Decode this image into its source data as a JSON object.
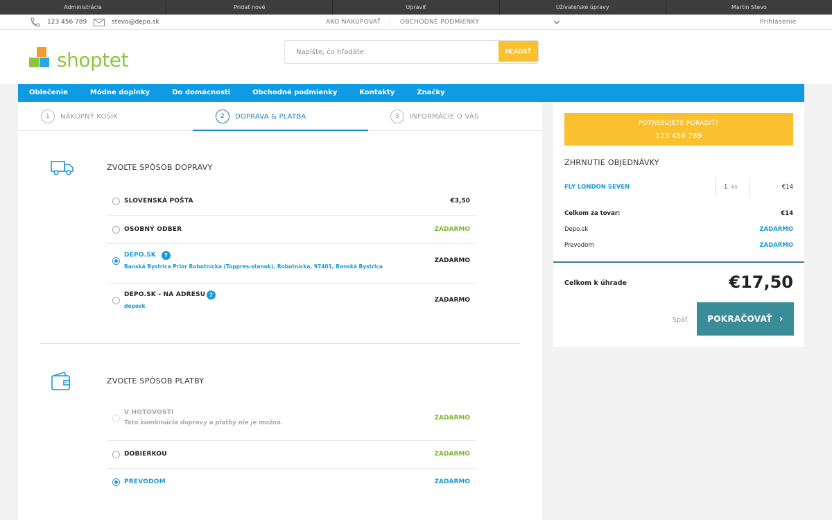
{
  "admin_bar": [
    "Administrácia",
    "Pridať nové",
    "Upraviť",
    "Užívateľské úpravy",
    "Martin Stevo"
  ],
  "topbar": {
    "phone": "123 456 789",
    "email": "stevo@depo.sk",
    "links": [
      "AKO NAKUPOVAŤ",
      "OBCHODNÉ PODMIENKY"
    ],
    "login": "Prihlásenie"
  },
  "header": {
    "logo_text": "shoptet",
    "search_placeholder": "Napíšte, čo hľadáte",
    "search_button": "HĽADAŤ"
  },
  "nav": [
    "Oblečenie",
    "Módne doplnky",
    "Do domácnosti",
    "Obchodné podmienky",
    "Kontakty",
    "Značky"
  ],
  "steps": [
    {
      "num": "1",
      "label": "NÁKUPNÝ KOŠÍK",
      "active": false
    },
    {
      "num": "2",
      "label": "DOPRAVA & PLATBA",
      "active": true
    },
    {
      "num": "3",
      "label": "INFORMÁCIE O VÁS",
      "active": false
    }
  ],
  "shipping": {
    "title": "ZVOĽTE SPÔSOB DOPRAVY",
    "options": [
      {
        "label": "SLOVENSKÁ POŠTA",
        "price": "€3,50"
      },
      {
        "label": "OSOBNÝ ODBER",
        "price": "ZADARMO"
      },
      {
        "label": "DEPO.SK",
        "sub": "Banská Bystrica Prior Robotnícka (Toppres-stanok), Robotnícka, 97401, Banská Bystrica",
        "price": "ZADARMO",
        "selected": true
      },
      {
        "label": "DEPO.SK - NA ADRESU",
        "sub": "deposk",
        "price": "ZADARMO"
      }
    ]
  },
  "payment": {
    "title": "ZVOĽTE SPÔSOB PLATBY",
    "options": [
      {
        "label": "V HOTOVOSTI",
        "sub": "Táto kombinácia dopravy a platby nie je možná.",
        "price": "ZADARMO",
        "disabled": true
      },
      {
        "label": "DOBIERKOU",
        "price": "ZADARMO"
      },
      {
        "label": "PREVODOM",
        "price": "ZADARMO",
        "selected": true
      }
    ]
  },
  "summary": {
    "advice_line1": "POTREBUJETE PORADIŤ?",
    "advice_line2": "123 456 789",
    "title": "ZHRNUTIE OBJEDNÁVKY",
    "item": {
      "name": "FLY LONDON SEVEN",
      "qty": "1",
      "unit": "ks",
      "price": "€14"
    },
    "lines": [
      {
        "label": "Celkom za tovar:",
        "value": "€14"
      },
      {
        "label": "Depo.sk",
        "value": "ZADARMO"
      },
      {
        "label": "Prevodom",
        "value": "ZADARMO"
      }
    ],
    "total_label": "Celkom k úhrade",
    "total_value": "€17,50",
    "back": "Späť",
    "continue": "POKRAČOVAŤ"
  },
  "colors": {
    "accent_blue": "#0f9be3",
    "yellow": "#fbc02d",
    "green": "#7cb82f",
    "teal": "#3b8c99"
  }
}
